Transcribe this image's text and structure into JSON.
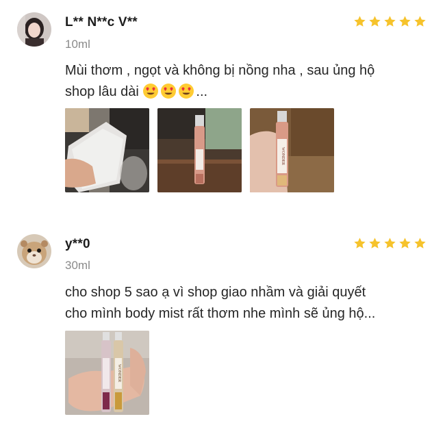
{
  "reviews": [
    {
      "username": "L** N**c V**",
      "variant": "10ml",
      "rating": 5,
      "text_line1": "Mùi thơm , ngọt và không bị nồng nha , sau ủng hộ",
      "text_line2_before": "shop lâu dài ",
      "text_line2_after": "...",
      "emoji": "heart-eyes-emoji",
      "photo_count": 3
    },
    {
      "username": "y**0",
      "variant": "30ml",
      "rating": 5,
      "text_line1": "cho shop 5 sao ạ vì shop giao nhầm và giải quyết",
      "text_line2": "cho mình body mist rất thơm nhe mình sẽ ủng hộ...",
      "photo_count": 1
    }
  ],
  "colors": {
    "star": "#f6c32c",
    "username": "#1c1c1c",
    "variant": "#8a8a8a",
    "text": "#262626"
  },
  "photo_labels": {
    "product_label": "WONDER",
    "product_label_2": "WONDER"
  }
}
